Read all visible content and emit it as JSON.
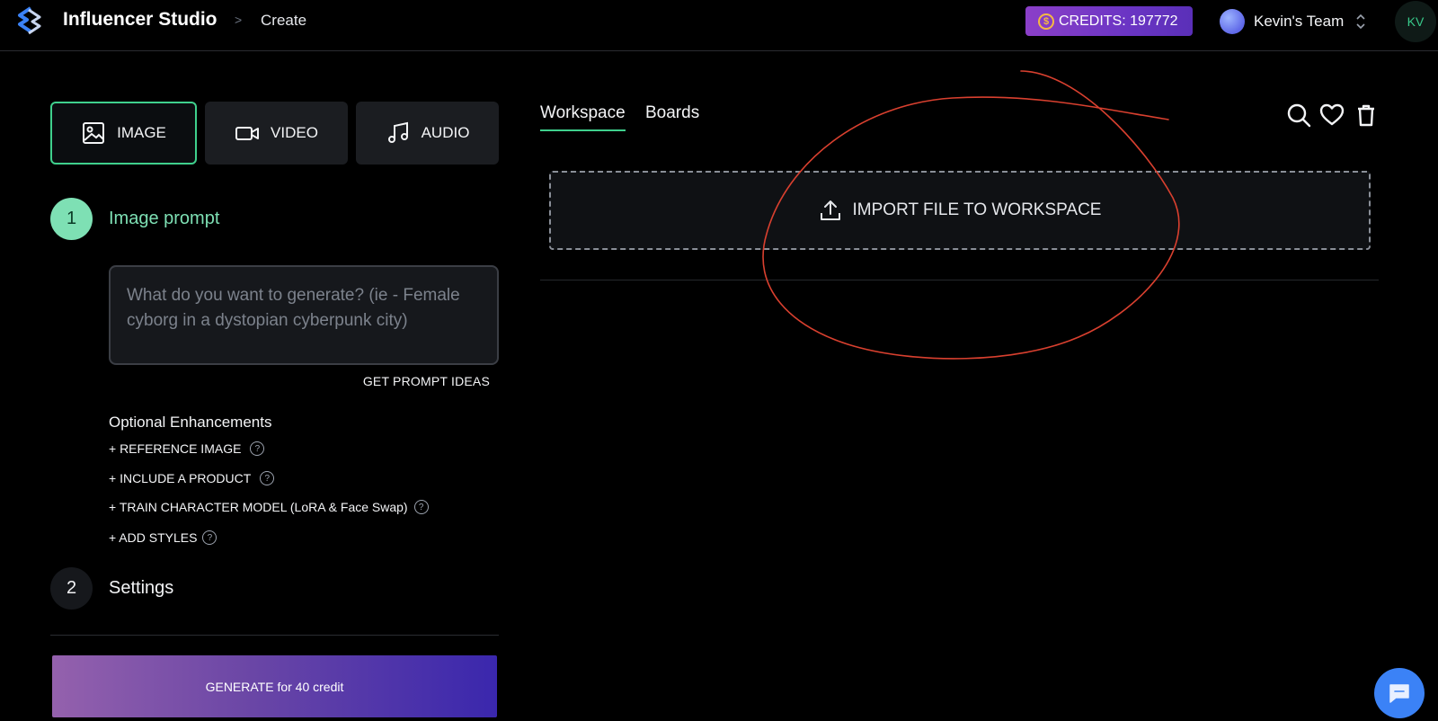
{
  "header": {
    "app_title": "Influencer Studio",
    "breadcrumb_separator": ">",
    "breadcrumb_current": "Create",
    "credits_coin": "$",
    "credits_label": "CREDITS: 197772",
    "team_name": "Kevin's Team",
    "user_initials": "KV"
  },
  "modes": [
    {
      "label": "IMAGE",
      "icon": "image-icon",
      "active": true
    },
    {
      "label": "VIDEO",
      "icon": "video-camera-icon",
      "active": false
    },
    {
      "label": "AUDIO",
      "icon": "music-note-icon",
      "active": false
    }
  ],
  "steps": {
    "step1": {
      "number": "1",
      "title": "Image prompt"
    },
    "step2": {
      "number": "2",
      "title": "Settings"
    }
  },
  "prompt": {
    "placeholder": "What do you want to generate? (ie - Female cyborg in a dystopian cyberpunk city)",
    "value": "",
    "ideas_label": "GET PROMPT IDEAS"
  },
  "enhancements": {
    "title": "Optional Enhancements",
    "items": [
      "+ REFERENCE IMAGE",
      "+ INCLUDE A PRODUCT",
      "+ TRAIN CHARACTER MODEL (LoRA & Face Swap)",
      "+ ADD STYLES"
    ],
    "help_glyph": "?"
  },
  "generate_label": "GENERATE for 40 credit",
  "workspace": {
    "tabs": [
      {
        "label": "Workspace",
        "active": true
      },
      {
        "label": "Boards",
        "active": false
      }
    ],
    "tools": [
      "search-icon",
      "heart-icon",
      "trash-icon"
    ],
    "import_label": "IMPORT FILE TO WORKSPACE"
  },
  "colors": {
    "accent_green": "#3fd08d",
    "step_green": "#7ee0b4",
    "credits_purple": "#6b35c4",
    "annotation_red": "#d9402f",
    "chat_blue": "#3b82f6"
  }
}
